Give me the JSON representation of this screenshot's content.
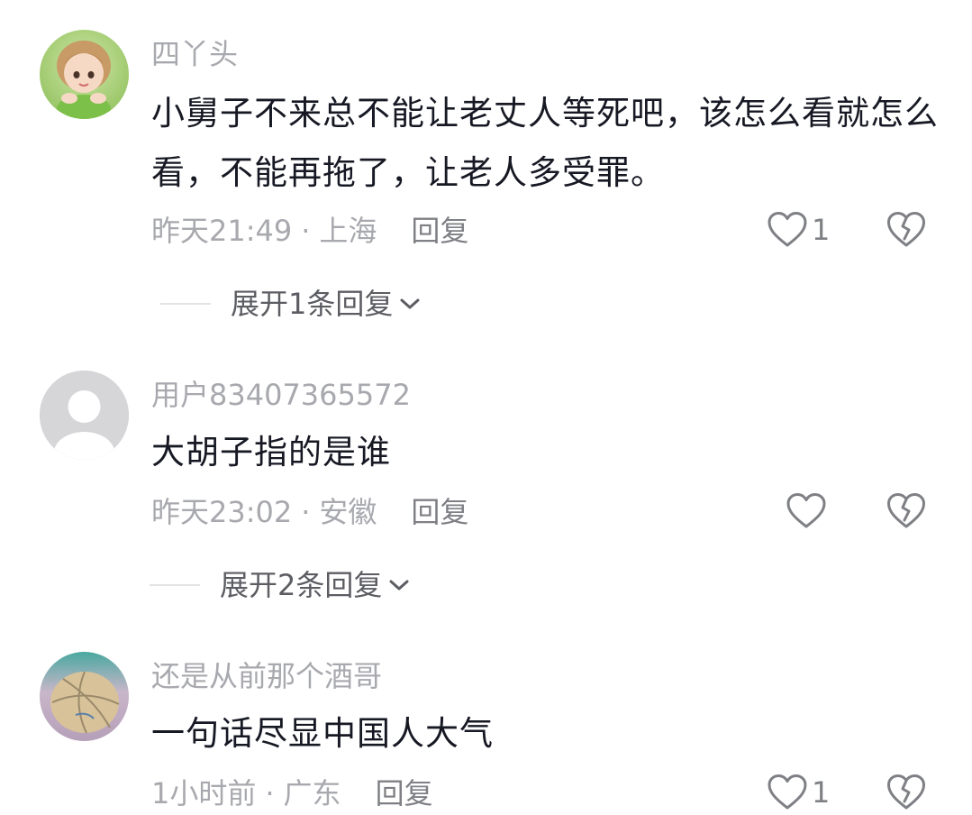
{
  "comments": [
    {
      "username": "四丫头",
      "content": "小舅子不来总不能让老丈人等死吧，该怎么看就怎么看，不能再拖了，让老人多受罪。",
      "time": "昨天21:49",
      "separator": "·",
      "location": "上海",
      "reply_label": "回复",
      "like_count": "1",
      "expand_label": "展开1条回复",
      "avatar_icon": "girl-avatar"
    },
    {
      "username": "用户83407365572",
      "content": "大胡子指的是谁",
      "time": "昨天23:02",
      "separator": "·",
      "location": "安徽",
      "reply_label": "回复",
      "like_count": "",
      "expand_label": "展开2条回复",
      "avatar_icon": "default-user-avatar"
    },
    {
      "username": "还是从前那个酒哥",
      "content": "一句话尽显中国人大气",
      "time": "1小时前",
      "separator": "·",
      "location": "广东",
      "reply_label": "回复",
      "like_count": "1",
      "avatar_icon": "basketball-avatar"
    }
  ],
  "colors": {
    "text_primary": "#161823",
    "text_secondary": "#a8a9ae",
    "icon": "#7f8085"
  }
}
